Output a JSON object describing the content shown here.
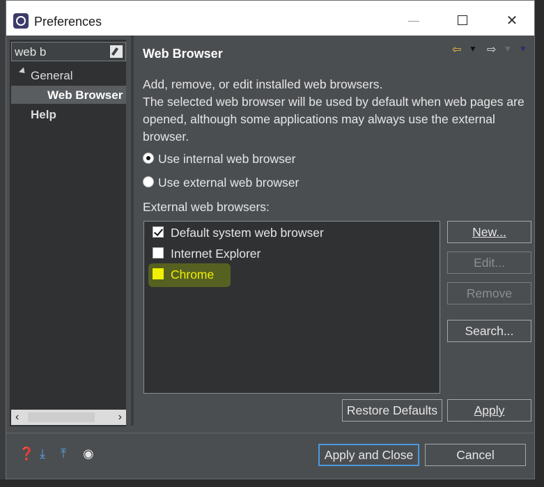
{
  "window": {
    "title": "Preferences"
  },
  "filter": {
    "value": "web b"
  },
  "tree": {
    "items": [
      {
        "label": "General"
      },
      {
        "label": "Web Browser"
      },
      {
        "label": "Help"
      }
    ]
  },
  "page": {
    "title": "Web Browser",
    "description": "Add, remove, or edit installed web browsers.\nThe selected web browser will be used by default when web pages are opened, although some applications may always use the external browser.",
    "radio_internal": "Use internal web browser",
    "radio_external": "Use external web browser",
    "external_label": "External web browsers:",
    "browsers": [
      {
        "label": "Default system web browser",
        "checked": true
      },
      {
        "label": "Internet Explorer",
        "checked": false
      },
      {
        "label": "Chrome",
        "checked": false,
        "highlight": true
      }
    ],
    "buttons": {
      "new": "New...",
      "edit": "Edit...",
      "remove": "Remove",
      "search": "Search...",
      "restore": "Restore Defaults",
      "apply": "Apply"
    }
  },
  "footer": {
    "apply_close": "Apply and Close",
    "cancel": "Cancel"
  },
  "colors": {
    "dialog_bg": "#4b4e51",
    "primary_border": "#4a9adf",
    "highlight": "#f0f000"
  }
}
